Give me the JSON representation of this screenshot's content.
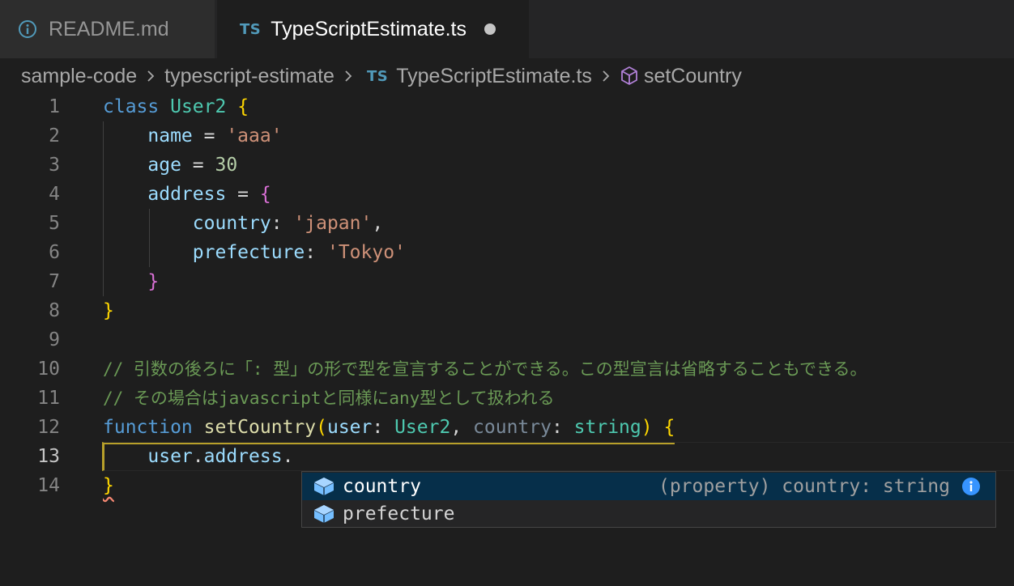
{
  "tabs": [
    {
      "label": "README.md",
      "icon": "info-icon"
    },
    {
      "badge": "TS",
      "label": "TypeScriptEstimate.ts",
      "dirty": true
    }
  ],
  "breadcrumb": {
    "items": [
      "sample-code",
      "typescript-estimate",
      "TypeScriptEstimate.ts",
      "setCountry"
    ],
    "ts_badge": "TS",
    "symbol_icon": "cube-icon"
  },
  "editor": {
    "line_numbers": [
      "1",
      "2",
      "3",
      "4",
      "5",
      "6",
      "7",
      "8",
      "9",
      "10",
      "11",
      "12",
      "13",
      "14"
    ],
    "active_line": "13",
    "tokens": {
      "l1_class": "class",
      "l1_name": "User2",
      "l1_brace": "{",
      "l2_prop": "name",
      "l2_eq": " = ",
      "l2_val": "'aaa'",
      "l3_prop": "age",
      "l3_eq": " = ",
      "l3_val": "30",
      "l4_prop": "address",
      "l4_eq": " = ",
      "l4_brace": "{",
      "l5_prop": "country",
      "l5_colon": ": ",
      "l5_val": "'japan'",
      "l5_comma": ",",
      "l6_prop": "prefecture",
      "l6_colon": ": ",
      "l6_val": "'Tokyo'",
      "l7_brace": "}",
      "l8_brace": "}",
      "l10_comment": "// 引数の後ろに「: 型」の形で型を宣言することができる。この型宣言は省略することもできる。",
      "l11_comment": "// その場合はjavascriptと同様にany型として扱われる",
      "l12_function": "function",
      "l12_name": "setCountry",
      "l12_paren_open": "(",
      "l12_p1": "user",
      "l12_colon1": ": ",
      "l12_t1": "User2",
      "l12_comma": ", ",
      "l12_p2": "country",
      "l12_colon2": ": ",
      "l12_t2": "string",
      "l12_paren_close": ")",
      "l12_brace": "{",
      "l13_obj": "user",
      "l13_dot1": ".",
      "l13_prop": "address",
      "l13_dot2": ".",
      "l14_brace": "}"
    }
  },
  "suggest": {
    "items": [
      {
        "label": "country",
        "detail": "(property) country: string",
        "icon": "property-icon",
        "selected": true
      },
      {
        "label": "prefecture",
        "icon": "property-icon",
        "selected": false
      }
    ],
    "info_icon": "info-icon"
  },
  "colors": {
    "keyword": "#569cd6",
    "type": "#4ec9b0",
    "property": "#9cdcfe",
    "string": "#ce9178",
    "number": "#b5cea8",
    "function": "#dcdcaa",
    "comment": "#6a9955",
    "bracket_gold": "#ffd700",
    "bracket_magenta": "#da70d6",
    "suggest_selected_bg": "#062f4a",
    "ts_badge": "#519aba"
  }
}
